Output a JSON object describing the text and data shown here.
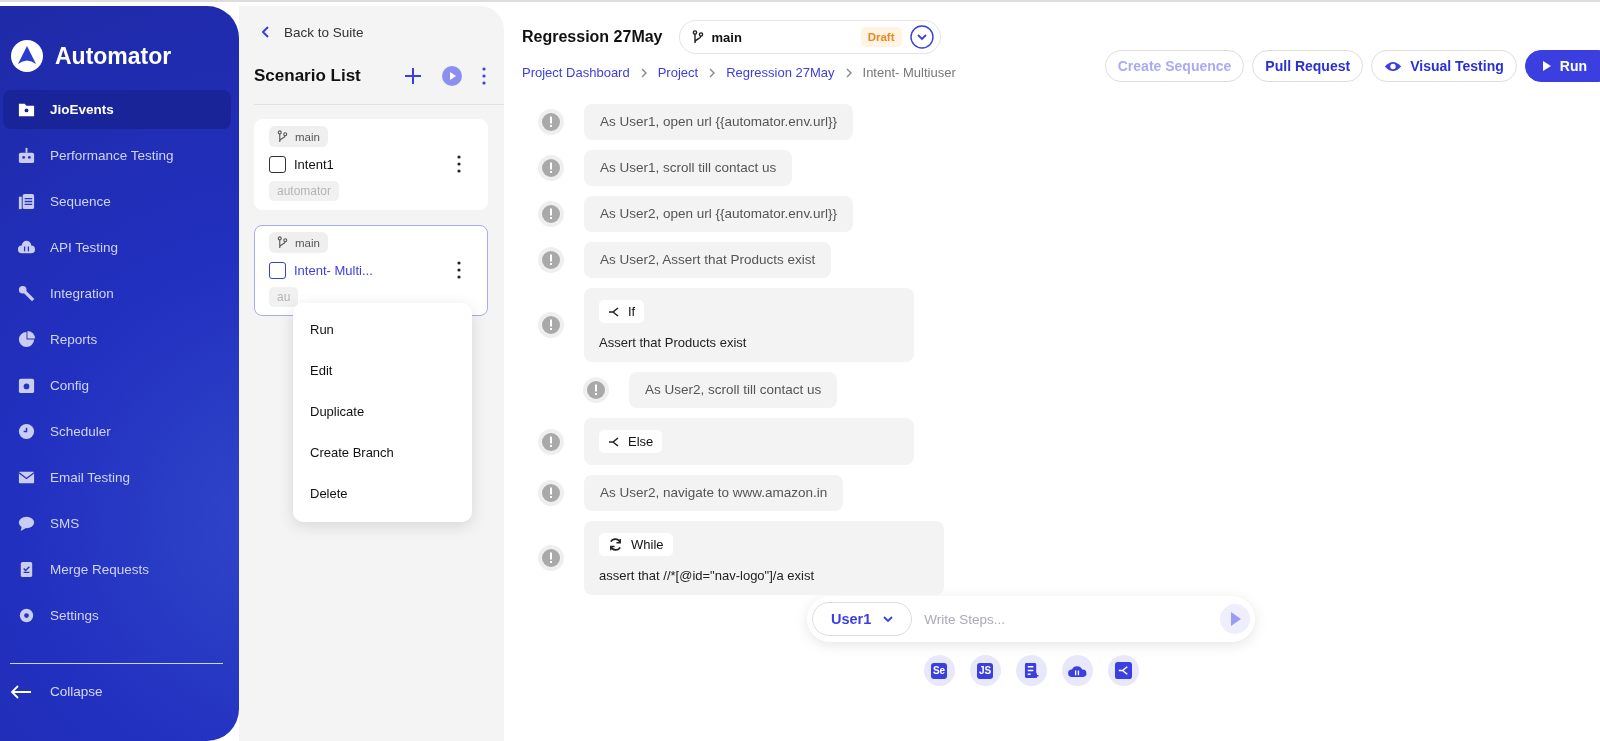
{
  "sidebar": {
    "logo": "Automator",
    "items": [
      {
        "label": "JioEvents",
        "selected": true
      },
      {
        "label": "Performance Testing",
        "selected": false
      },
      {
        "label": "Sequence",
        "selected": false
      },
      {
        "label": "API Testing",
        "selected": false
      },
      {
        "label": "Integration",
        "selected": false
      },
      {
        "label": "Reports",
        "selected": false
      },
      {
        "label": "Config",
        "selected": false
      },
      {
        "label": "Scheduler",
        "selected": false
      },
      {
        "label": "Email Testing",
        "selected": false
      },
      {
        "label": "SMS",
        "selected": false
      },
      {
        "label": "Merge Requests",
        "selected": false
      },
      {
        "label": "Settings",
        "selected": false
      }
    ],
    "collapse": "Collapse"
  },
  "scenario_panel": {
    "back": "Back to Suite",
    "title": "Scenario List",
    "scenarios": [
      {
        "branch": "main",
        "name": "Intent1",
        "checked": false,
        "selected": false,
        "tag": "automator"
      },
      {
        "branch": "main",
        "name": "Intent- Multi...",
        "checked": false,
        "selected": true,
        "tag": "au"
      }
    ],
    "context_menu": [
      "Run",
      "Edit",
      "Duplicate",
      "Create Branch",
      "Delete"
    ]
  },
  "header": {
    "title": "Regression 27May",
    "branch": "main",
    "status": "Draft",
    "breadcrumbs": [
      {
        "label": "Project Dashboard",
        "current": false
      },
      {
        "label": "Project",
        "current": false
      },
      {
        "label": "Regression 27May",
        "current": false
      },
      {
        "label": "Intent- Multiuser",
        "current": true
      }
    ],
    "actions": [
      {
        "label": "Create Sequence",
        "kind": "outline",
        "disabled": true
      },
      {
        "label": "Pull Request",
        "kind": "outline",
        "disabled": false
      },
      {
        "label": "Visual Testing",
        "kind": "eye",
        "disabled": false
      },
      {
        "label": "Run",
        "kind": "primary",
        "disabled": false
      }
    ]
  },
  "steps": [
    {
      "kind": "step",
      "text": "As User1, open url {{automator.env.url}}"
    },
    {
      "kind": "step",
      "text": "As User1, scroll till contact us"
    },
    {
      "kind": "step",
      "text": "As User2, open url {{automator.env.url}}"
    },
    {
      "kind": "step",
      "text": "As User2, Assert that Products exist"
    },
    {
      "kind": "branch",
      "keyword": "If",
      "text": "Assert that Products exist",
      "children": [
        {
          "text": "As User2, scroll till contact us"
        }
      ]
    },
    {
      "kind": "branch",
      "keyword": "Else"
    },
    {
      "kind": "step",
      "text": "As User2, navigate to www.amazon.in"
    },
    {
      "kind": "loop",
      "keyword": "While",
      "text": "assert that //*[@id=\"nav-logo\"]/a exist"
    }
  ],
  "composer": {
    "user": "User1",
    "placeholder": "Write Steps..."
  },
  "tools": [
    {
      "kind": "selenium",
      "label": "Se"
    },
    {
      "kind": "js",
      "label": "JS"
    },
    {
      "kind": "form"
    },
    {
      "kind": "cloud"
    },
    {
      "kind": "branch"
    }
  ]
}
